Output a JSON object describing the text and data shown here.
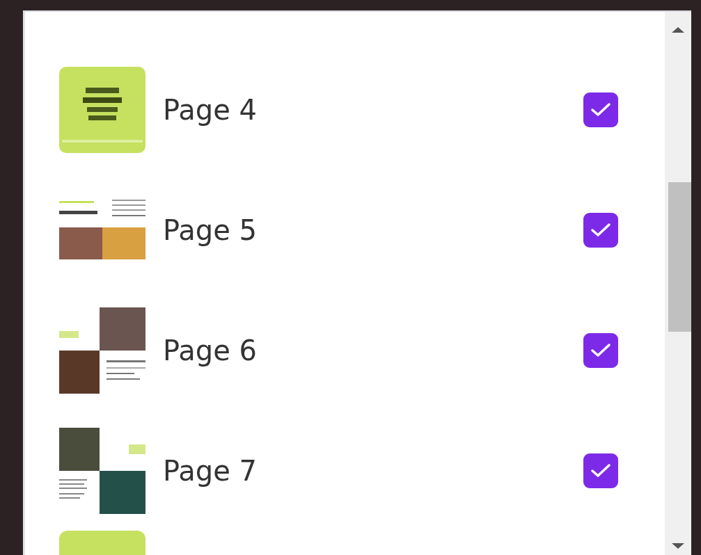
{
  "pages": [
    {
      "label": "Page 4",
      "kind": "titlecard",
      "checked": true
    },
    {
      "label": "Page 5",
      "kind": "textphotos",
      "checked": true
    },
    {
      "label": "Page 6",
      "kind": "grid",
      "checked": true
    },
    {
      "label": "Page 7",
      "kind": "collage",
      "checked": true
    }
  ],
  "partial_next": {
    "kind": "plain"
  }
}
